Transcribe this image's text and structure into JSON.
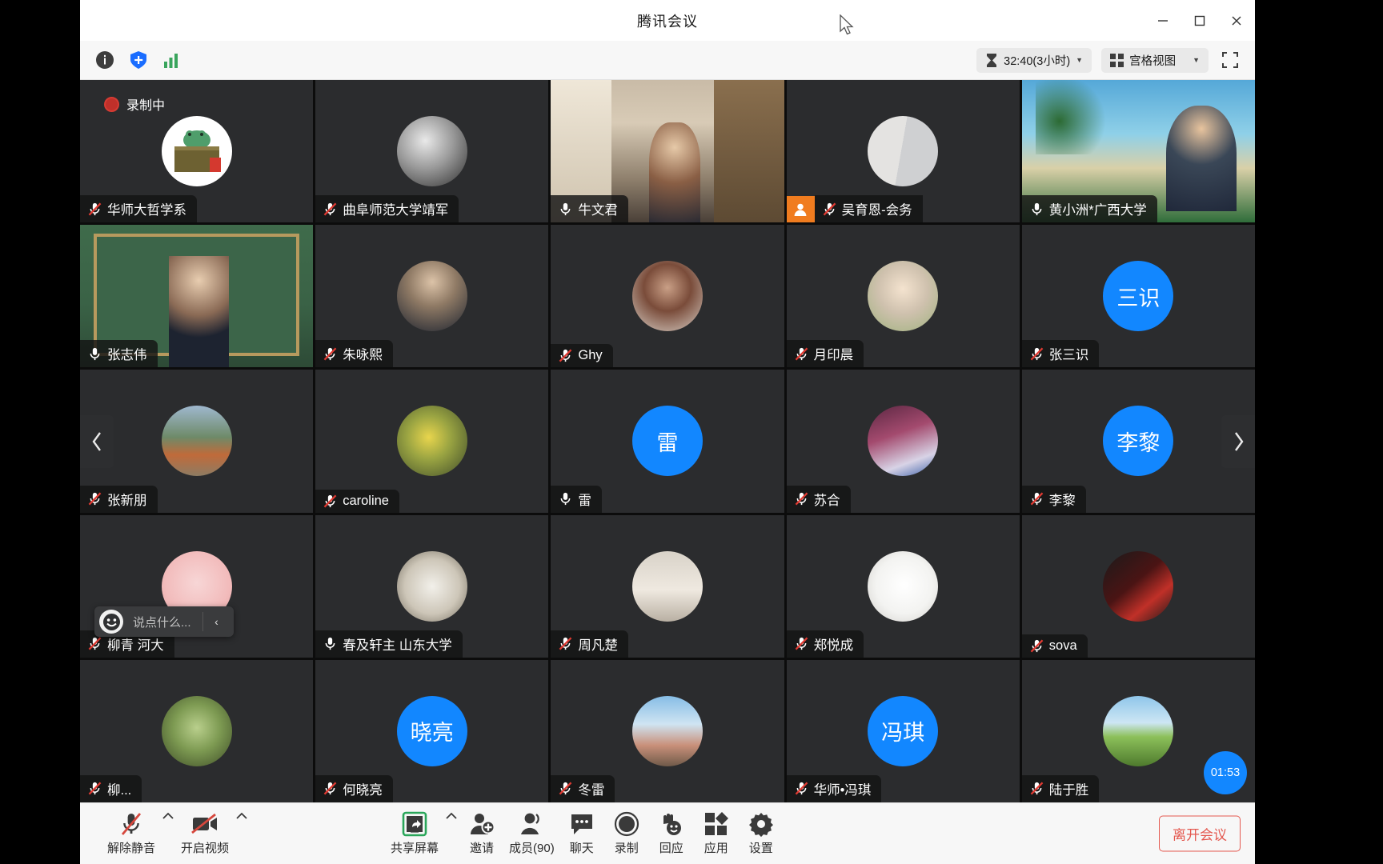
{
  "window": {
    "title": "腾讯会议",
    "minimize": "minimize-icon",
    "maximize": "maximize-icon",
    "close": "close-icon"
  },
  "toolbar": {
    "info_icon": "info-icon",
    "shield_icon": "shield-icon",
    "network_icon": "network-signal-icon",
    "timer": "32:40(3小时)",
    "view_mode": "宫格视图",
    "fullscreen_icon": "fullscreen-icon"
  },
  "stage": {
    "recording_label": "录制中",
    "prev_page": "‹",
    "next_page": "›",
    "quick_chat_placeholder": "说点什么...",
    "quick_chat_emoji": "☺",
    "quick_chat_collapse": "‹",
    "timer_bubble": "01:53"
  },
  "participants": [
    {
      "name": "华师大哲学系",
      "muted": true,
      "type": "avatar",
      "avatar": "frog-desk",
      "initial": "",
      "host": false,
      "recording": true
    },
    {
      "name": "曲阜师范大学靖军",
      "muted": true,
      "type": "avatar",
      "avatar": "photo-bw",
      "initial": "",
      "host": false
    },
    {
      "name": "牛文君",
      "muted": false,
      "type": "video",
      "avatar": "room-video",
      "initial": "",
      "host": false
    },
    {
      "name": "吴育恩-会务",
      "muted": true,
      "type": "avatar",
      "avatar": "blank-gray",
      "initial": "",
      "host": true
    },
    {
      "name": "黄小洲*广西大学",
      "muted": false,
      "type": "video",
      "avatar": "beach-video",
      "initial": "",
      "host": false
    },
    {
      "name": "张志伟",
      "muted": false,
      "type": "video",
      "avatar": "classroom-video",
      "initial": "",
      "host": false,
      "active": true
    },
    {
      "name": "朱咏熙",
      "muted": true,
      "type": "avatar",
      "avatar": "woman-photo",
      "initial": "",
      "host": false
    },
    {
      "name": "Ghy",
      "muted": true,
      "type": "avatar",
      "avatar": "illust-scarf",
      "initial": "",
      "host": false
    },
    {
      "name": "月印晨",
      "muted": true,
      "type": "avatar",
      "avatar": "anime-girl",
      "initial": "",
      "host": false
    },
    {
      "name": "张三识",
      "muted": true,
      "type": "initial",
      "avatar": "",
      "initial": "三识",
      "host": false
    },
    {
      "name": "张新朋",
      "muted": true,
      "type": "avatar",
      "avatar": "outdoor-person",
      "initial": "",
      "host": false
    },
    {
      "name": "caroline",
      "muted": true,
      "type": "avatar",
      "avatar": "yellow-flowers",
      "initial": "",
      "host": false
    },
    {
      "name": "雷",
      "muted": false,
      "type": "initial",
      "avatar": "",
      "initial": "雷",
      "host": false
    },
    {
      "name": "苏合",
      "muted": true,
      "type": "avatar",
      "avatar": "anime-pink",
      "initial": "",
      "host": false
    },
    {
      "name": "李黎",
      "muted": true,
      "type": "initial",
      "avatar": "",
      "initial": "李黎",
      "host": false
    },
    {
      "name": "柳青 河大",
      "muted": true,
      "type": "avatar",
      "avatar": "pink-bear",
      "initial": "",
      "host": false
    },
    {
      "name": "春及轩主 山东大学",
      "muted": false,
      "type": "avatar",
      "avatar": "ink-painting",
      "initial": "",
      "host": false
    },
    {
      "name": "周凡楚",
      "muted": true,
      "type": "avatar",
      "avatar": "dog-photo",
      "initial": "",
      "host": false
    },
    {
      "name": "郑悦成",
      "muted": true,
      "type": "avatar",
      "avatar": "ink-bird",
      "initial": "",
      "host": false
    },
    {
      "name": "sova",
      "muted": true,
      "type": "avatar",
      "avatar": "dark-red-portrait",
      "initial": "",
      "host": false
    },
    {
      "name": "柳...",
      "muted": true,
      "type": "avatar",
      "avatar": "tulip",
      "initial": "",
      "host": false
    },
    {
      "name": "何晓亮",
      "muted": true,
      "type": "initial",
      "avatar": "",
      "initial": "晓亮",
      "host": false
    },
    {
      "name": "冬雷",
      "muted": true,
      "type": "avatar",
      "avatar": "woman-sky",
      "initial": "",
      "host": false
    },
    {
      "name": "华师•冯琪",
      "muted": true,
      "type": "initial",
      "avatar": "",
      "initial": "冯琪",
      "host": false
    },
    {
      "name": "陆于胜",
      "muted": true,
      "type": "avatar",
      "avatar": "green-field",
      "initial": "",
      "host": false
    }
  ],
  "bottombar": {
    "controls": [
      {
        "label": "解除静音",
        "icon": "mic-muted-icon",
        "has_chevron": true
      },
      {
        "label": "开启视频",
        "icon": "camera-off-icon",
        "has_chevron": true
      },
      {
        "label": "共享屏幕",
        "icon": "share-screen-icon",
        "has_chevron": true
      },
      {
        "label": "邀请",
        "icon": "invite-user-icon",
        "has_chevron": false
      },
      {
        "label": "成员(90)",
        "icon": "participants-icon",
        "has_chevron": false
      },
      {
        "label": "聊天",
        "icon": "chat-icon",
        "has_chevron": false
      },
      {
        "label": "录制",
        "icon": "record-icon",
        "has_chevron": false
      },
      {
        "label": "回应",
        "icon": "reaction-icon",
        "has_chevron": false
      },
      {
        "label": "应用",
        "icon": "apps-icon",
        "has_chevron": false
      },
      {
        "label": "设置",
        "icon": "settings-gear-icon",
        "has_chevron": false
      }
    ],
    "leave_label": "离开会议"
  },
  "colors": {
    "accent_blue": "#1287ff",
    "leave_red": "#e4584f",
    "host_orange": "#f07c1f",
    "active_border": "#c6b26a",
    "recording_red": "#d63b33"
  }
}
